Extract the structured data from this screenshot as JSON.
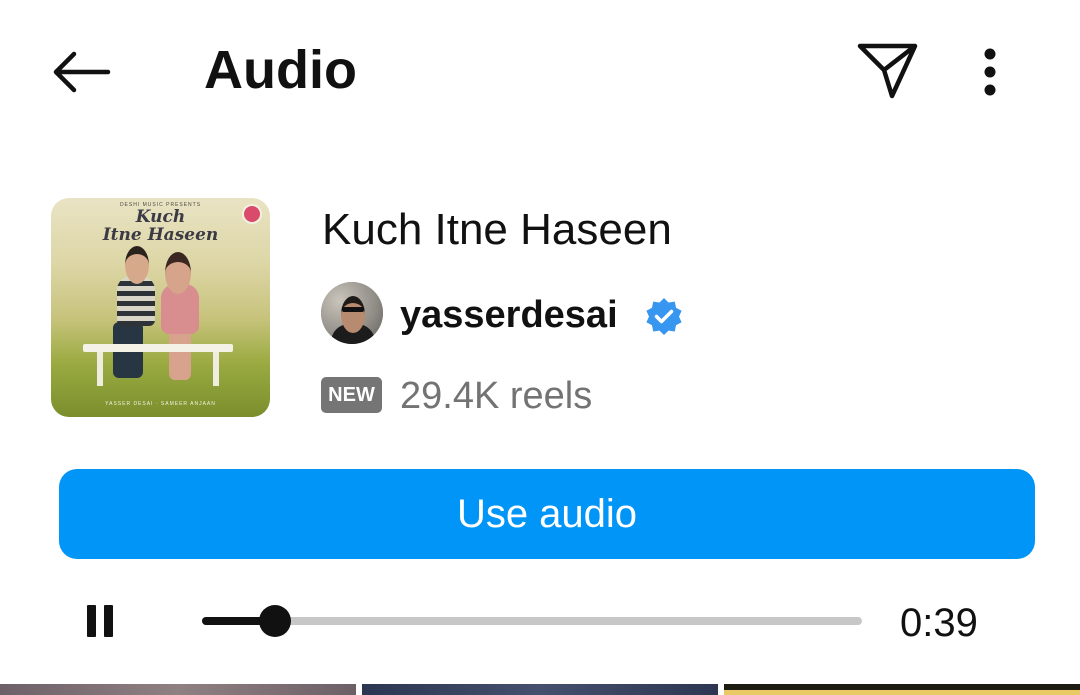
{
  "header": {
    "title": "Audio",
    "back_icon": "arrow-left-icon",
    "share_icon": "paper-plane-icon",
    "more_icon": "more-vertical-icon"
  },
  "album": {
    "cover_title": "Kuch\nItne Haseen",
    "cover_top_text": "DESHI MUSIC PRESENTS",
    "cover_bottom_text": "YASSER DESAI · SAMEER ANJAAN"
  },
  "track": {
    "title": "Kuch Itne Haseen",
    "artist": "yasserdesai",
    "verified": true,
    "badge": "NEW",
    "reels_count": "29.4K reels"
  },
  "actions": {
    "use_audio_label": "Use audio"
  },
  "player": {
    "state_icon": "pause-icon",
    "progress": 0.11,
    "time": "0:39"
  },
  "colors": {
    "accent": "#0095f6",
    "badge_bg": "#757575",
    "muted_text": "#737373"
  }
}
